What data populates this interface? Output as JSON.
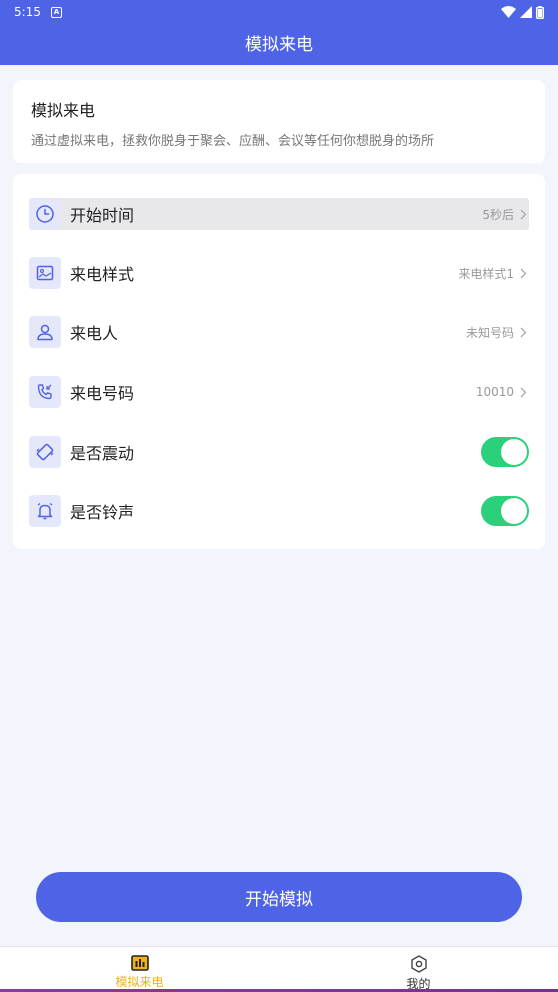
{
  "status_bar": {
    "time": "5:15",
    "a_badge": "A"
  },
  "header": {
    "title": "模拟来电"
  },
  "intro": {
    "title": "模拟来电",
    "description": "通过虚拟来电，拯救你脱身于聚会、应酬、会议等任何你想脱身的场所"
  },
  "settings": {
    "items": [
      {
        "label": "开始时间",
        "value": "5秒后",
        "icon": "clock-icon"
      },
      {
        "label": "来电样式",
        "value": "来电样式1",
        "icon": "image-icon"
      },
      {
        "label": "来电人",
        "value": "未知号码",
        "icon": "person-icon"
      },
      {
        "label": "来电号码",
        "value": "10010",
        "icon": "phone-incoming-icon"
      },
      {
        "label": "是否震动",
        "toggle_on": true,
        "icon": "vibrate-icon"
      },
      {
        "label": "是否铃声",
        "toggle_on": true,
        "icon": "bell-icon"
      }
    ]
  },
  "start_button": {
    "label": "开始模拟"
  },
  "tabbar": {
    "tabs": [
      {
        "label": "模拟来电",
        "active": true,
        "icon": "chart-icon"
      },
      {
        "label": "我的",
        "active": false,
        "icon": "settings-hex-icon"
      }
    ]
  },
  "colors": {
    "primary": "#4e63e6",
    "toggle_on": "#2bd17a",
    "tab_active": "#f2b01e",
    "background": "#f3f5fd"
  }
}
